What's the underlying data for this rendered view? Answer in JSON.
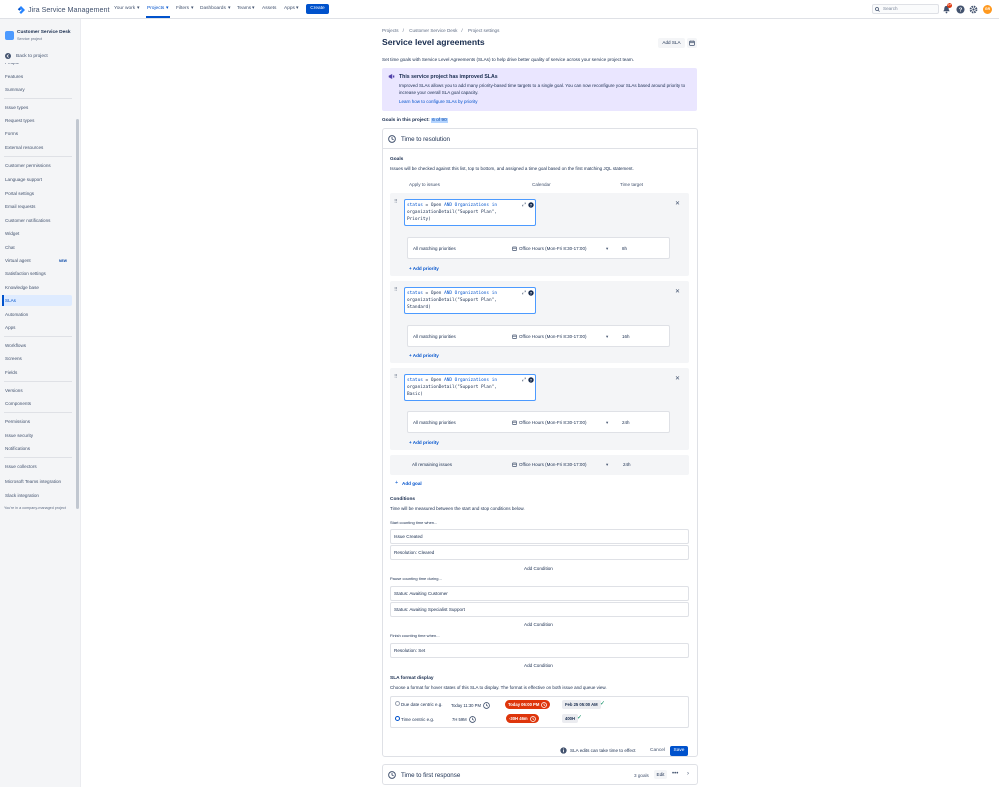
{
  "nav": {
    "product": "Jira Service Management",
    "items": [
      "Your work",
      "Projects",
      "Filters",
      "Dashboards",
      "Teams",
      "Assets",
      "Apps"
    ],
    "create": "Create",
    "search_placeholder": "Search",
    "notifications_count": "9+",
    "avatar_initials": "GR"
  },
  "sidebar": {
    "project_name": "Customer Service Desk",
    "project_type": "Service project",
    "back": "Back to project",
    "partial_top": "People",
    "items": [
      "Features",
      "Summary",
      "Issue types",
      "Request types",
      "Forms",
      "External resources",
      "Customer permissions",
      "Language support",
      "Portal settings",
      "Email requests",
      "Customer notifications",
      "Widget",
      "Chat",
      "Virtual agent",
      "Satisfaction settings",
      "Knowledge base",
      "SLAs",
      "Automation",
      "Apps",
      "Workflows",
      "Screens",
      "Fields",
      "Versions",
      "Components",
      "Permissions",
      "Issue security",
      "Notifications",
      "Issue collectors",
      "Microsoft Teams integration",
      "Slack integration"
    ],
    "new_badge": "NEW",
    "footer": "You're in a company-managed project"
  },
  "breadcrumb": [
    "Projects",
    "Customer Service Desk",
    "Project settings"
  ],
  "page_title": "Service level agreements",
  "add_sla": "Add SLA",
  "lead": "Set time goals with Service Level Agreements (SLAs) to help drive better quality of service across your service project team.",
  "info": {
    "title": "This service project has improved SLAs",
    "body": "Improved SLAs allows you to add many priority-based time targets to a single goal. You can now reconfigure your SLAs based around priority to increase your overall SLA goal capacity.",
    "link": "Learn how to configure SLAs by priority"
  },
  "goals_line": {
    "label": "Goals in this project:",
    "count": "6 of 90"
  },
  "sla": {
    "title": "Time to resolution",
    "goals_label": "Goals",
    "goals_desc": "Issues will be checked against this list, top to bottom, and assigned a time goal based on the first matching JQL statement.",
    "col_apply": "Apply to issues",
    "col_calendar": "Calendar",
    "col_target": "Time target",
    "goals": [
      {
        "jql_plan": "\"Support Plan\",",
        "jql_level": "Priority)",
        "priority": "All matching priorities",
        "calendar": "Office Hours (Mon-Fri 8:30-17:00)",
        "target": "8h",
        "add_priority": "+ Add priority"
      },
      {
        "jql_plan": "\"Support Plan\",",
        "jql_level": "Standard)",
        "priority": "All matching priorities",
        "calendar": "Office Hours (Mon-Fri 8:30-17:00)",
        "target": "16h",
        "add_priority": "+ Add priority"
      },
      {
        "jql_plan": "\"Support Plan\",",
        "jql_level": "Basic)",
        "priority": "All matching priorities",
        "calendar": "Office Hours (Mon-Fri 8:30-17:00)",
        "target": "24h",
        "add_priority": "+ Add priority"
      }
    ],
    "jql_prefix": {
      "field": "status",
      "eq": "=",
      "value": "Open",
      "and": "AND",
      "org": "Organizations",
      "in": "in",
      "fn": "organizationDetail("
    },
    "remaining": {
      "label": "All remaining issues",
      "calendar": "Office Hours (Mon-Fri 8:30-17:00)",
      "target": "24h"
    },
    "add_goal": "Add goal",
    "conditions_label": "Conditions",
    "conditions_desc": "Time will be measured between the start and stop conditions below.",
    "start_label": "Start counting time when...",
    "start": [
      "Issue Created",
      "Resolution: Cleared"
    ],
    "pause_label": "Pause counting time during...",
    "pause": [
      "Status: Awaiting Customer",
      "Status: Awaiting Specialist Support"
    ],
    "finish_label": "Finish counting time when...",
    "finish": [
      "Resolution: Set"
    ],
    "add_condition": "Add Condition",
    "format_label": "SLA format display",
    "format_desc": "Choose a format for hover states of this SLA to display. The format is effective on both issue and queue view.",
    "format_due": {
      "label": "Due date centric e.g.",
      "ex1": "Today 11:30 PM",
      "ex2": "Today 06:00 PM",
      "ex3": "Feb 25 05:00 AM"
    },
    "format_time": {
      "label": "Time centric e.g.",
      "ex1": "7H 59M",
      "ex2": "-30H 46m",
      "ex3": "400H"
    },
    "edit_note": "SLA edits can take time to effect",
    "cancel": "Cancel",
    "save": "Save"
  },
  "sla2": {
    "title": "Time to first response",
    "goals": "3 goals",
    "edit": "Edit"
  },
  "colors": {
    "accent": "#0052CC",
    "info_bg": "#EAE6FF",
    "breach": "#DE350B",
    "ok": "#00875A"
  }
}
